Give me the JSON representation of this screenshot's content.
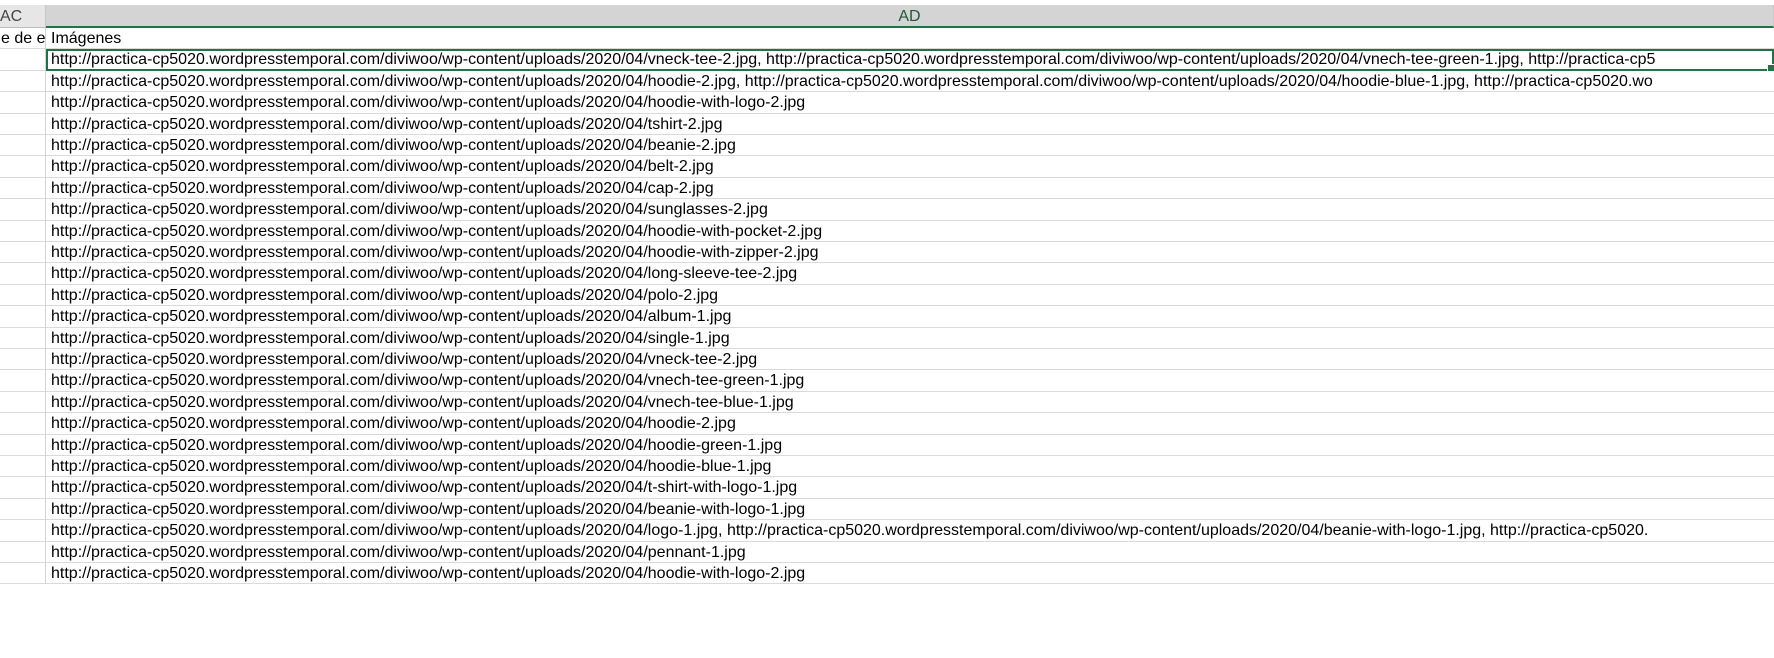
{
  "columns": {
    "ac": "AC",
    "ad": "AD"
  },
  "header_row": {
    "ac_text": "e de er",
    "ad_text": "Imágenes"
  },
  "rows": [
    "http://practica-cp5020.wordpresstemporal.com/diviwoo/wp-content/uploads/2020/04/vneck-tee-2.jpg, http://practica-cp5020.wordpresstemporal.com/diviwoo/wp-content/uploads/2020/04/vnech-tee-green-1.jpg, http://practica-cp5",
    "http://practica-cp5020.wordpresstemporal.com/diviwoo/wp-content/uploads/2020/04/hoodie-2.jpg, http://practica-cp5020.wordpresstemporal.com/diviwoo/wp-content/uploads/2020/04/hoodie-blue-1.jpg, http://practica-cp5020.wo",
    "http://practica-cp5020.wordpresstemporal.com/diviwoo/wp-content/uploads/2020/04/hoodie-with-logo-2.jpg",
    "http://practica-cp5020.wordpresstemporal.com/diviwoo/wp-content/uploads/2020/04/tshirt-2.jpg",
    "http://practica-cp5020.wordpresstemporal.com/diviwoo/wp-content/uploads/2020/04/beanie-2.jpg",
    "http://practica-cp5020.wordpresstemporal.com/diviwoo/wp-content/uploads/2020/04/belt-2.jpg",
    "http://practica-cp5020.wordpresstemporal.com/diviwoo/wp-content/uploads/2020/04/cap-2.jpg",
    "http://practica-cp5020.wordpresstemporal.com/diviwoo/wp-content/uploads/2020/04/sunglasses-2.jpg",
    "http://practica-cp5020.wordpresstemporal.com/diviwoo/wp-content/uploads/2020/04/hoodie-with-pocket-2.jpg",
    "http://practica-cp5020.wordpresstemporal.com/diviwoo/wp-content/uploads/2020/04/hoodie-with-zipper-2.jpg",
    "http://practica-cp5020.wordpresstemporal.com/diviwoo/wp-content/uploads/2020/04/long-sleeve-tee-2.jpg",
    "http://practica-cp5020.wordpresstemporal.com/diviwoo/wp-content/uploads/2020/04/polo-2.jpg",
    "http://practica-cp5020.wordpresstemporal.com/diviwoo/wp-content/uploads/2020/04/album-1.jpg",
    "http://practica-cp5020.wordpresstemporal.com/diviwoo/wp-content/uploads/2020/04/single-1.jpg",
    "http://practica-cp5020.wordpresstemporal.com/diviwoo/wp-content/uploads/2020/04/vneck-tee-2.jpg",
    "http://practica-cp5020.wordpresstemporal.com/diviwoo/wp-content/uploads/2020/04/vnech-tee-green-1.jpg",
    "http://practica-cp5020.wordpresstemporal.com/diviwoo/wp-content/uploads/2020/04/vnech-tee-blue-1.jpg",
    "http://practica-cp5020.wordpresstemporal.com/diviwoo/wp-content/uploads/2020/04/hoodie-2.jpg",
    "http://practica-cp5020.wordpresstemporal.com/diviwoo/wp-content/uploads/2020/04/hoodie-green-1.jpg",
    "http://practica-cp5020.wordpresstemporal.com/diviwoo/wp-content/uploads/2020/04/hoodie-blue-1.jpg",
    "http://practica-cp5020.wordpresstemporal.com/diviwoo/wp-content/uploads/2020/04/t-shirt-with-logo-1.jpg",
    "http://practica-cp5020.wordpresstemporal.com/diviwoo/wp-content/uploads/2020/04/beanie-with-logo-1.jpg",
    "http://practica-cp5020.wordpresstemporal.com/diviwoo/wp-content/uploads/2020/04/logo-1.jpg, http://practica-cp5020.wordpresstemporal.com/diviwoo/wp-content/uploads/2020/04/beanie-with-logo-1.jpg, http://practica-cp5020.",
    "http://practica-cp5020.wordpresstemporal.com/diviwoo/wp-content/uploads/2020/04/pennant-1.jpg",
    "http://practica-cp5020.wordpresstemporal.com/diviwoo/wp-content/uploads/2020/04/hoodie-with-logo-2.jpg"
  ],
  "colors": {
    "selection": "#217346",
    "spellcheck": "#e02020"
  }
}
